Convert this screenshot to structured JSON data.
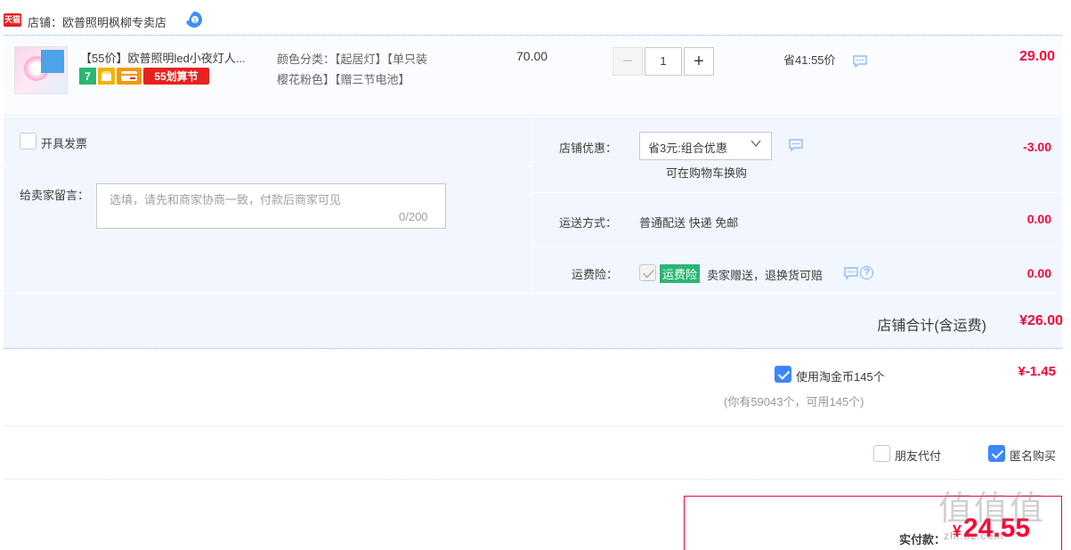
{
  "shop": {
    "badge": "天猫",
    "title": "店铺：欧普照明枫柳专卖店"
  },
  "item": {
    "title": "【55价】欧普照明led小夜灯人...",
    "tags": {
      "seven": "7",
      "promo": "55划算节"
    },
    "sku": {
      "label": "颜色分类：",
      "value_line1": "【起居灯】【单只装",
      "value_line2": "樱花粉色】【赠三节电池】"
    },
    "price": "70.00",
    "quantity": "1",
    "qty_minus": "−",
    "qty_plus": "+",
    "saving": "省41:55价",
    "subtotal": "29.00"
  },
  "options": {
    "invoice_label": "开具发票",
    "message_label": "给卖家留言：",
    "message_placeholder": "选填，请先和商家协商一致，付款后商家可见",
    "message_count": "0/200",
    "shop_discount_label": "店铺优惠：",
    "shop_discount_value": "省3元:组合优惠",
    "shop_discount_note": "可在购物车换购",
    "shop_discount_amount": "-3.00",
    "shipping_label": "运送方式：",
    "shipping_value": "普通配送 快递 免邮",
    "shipping_amount": "0.00",
    "insurance_label": "运费险：",
    "insurance_badge": "运费险",
    "insurance_desc": "卖家赠送，退换货可赔",
    "insurance_amount": "0.00",
    "help_glyph": "?"
  },
  "shop_total": {
    "label": "店铺合计(含运费)",
    "amount": "¥26.00"
  },
  "coins": {
    "label": "使用淘金币145个",
    "amount": "¥-1.45",
    "note": "(你有59043个，可用145个)"
  },
  "extra_options": {
    "friend_pay": "朋友代付",
    "anonymous": "匿名购买"
  },
  "payment": {
    "label": "实付款：",
    "currency": "¥",
    "amount": "24.55"
  },
  "watermark": {
    "text": "值值值",
    "url": "zhi.uz.com"
  },
  "colors": {
    "accent_red": "#ff0036",
    "accent_blue": "#3d85ff",
    "panel_bg": "#f2f7ff"
  }
}
